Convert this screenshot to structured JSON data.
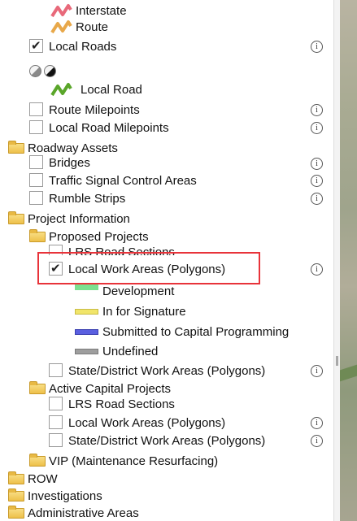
{
  "legend": {
    "interstate": "Interstate",
    "route": "Route",
    "local_road": "Local Road",
    "development": "Development",
    "in_for_signature": "In for Signature",
    "submitted": "Submitted to Capital Programming",
    "undefined": "Undefined"
  },
  "layers": {
    "local_roads": "Local Roads",
    "route_milepoints": "Route Milepoints",
    "local_road_milepoints": "Local Road Milepoints",
    "roadway_assets": "Roadway Assets",
    "bridges": "Bridges",
    "traffic_signal_control_areas": "Traffic Signal Control Areas",
    "rumble_strips": "Rumble Strips",
    "project_information": "Project Information",
    "proposed_projects": "Proposed Projects",
    "lrs_road_sections_1": "LRS Road Sections",
    "local_work_areas_1": "Local Work Areas (Polygons)",
    "state_district_work_areas_1": "State/District Work Areas (Polygons)",
    "active_capital_projects": "Active Capital Projects",
    "lrs_road_sections_2": "LRS Road Sections",
    "local_work_areas_2": "Local Work Areas (Polygons)",
    "state_district_work_areas_2": "State/District Work Areas (Polygons)",
    "vip": "VIP (Maintenance Resurfacing)",
    "row": "ROW",
    "investigations": "Investigations",
    "administrative_areas": "Administrative Areas"
  },
  "info_glyph": "i",
  "colors": {
    "interstate": "#e8697a",
    "route": "#e8a84a",
    "local_road": "#5aa62a",
    "development": "#7be08f",
    "in_for_signature": "#f1e56a",
    "submitted": "#5a5fe0",
    "undefined": "#9e9e9e",
    "highlight": "#e8333a"
  },
  "icons": [
    "checkbox",
    "folder-icon",
    "info-icon",
    "line-symbol-icon",
    "transparency-circle-icon"
  ]
}
